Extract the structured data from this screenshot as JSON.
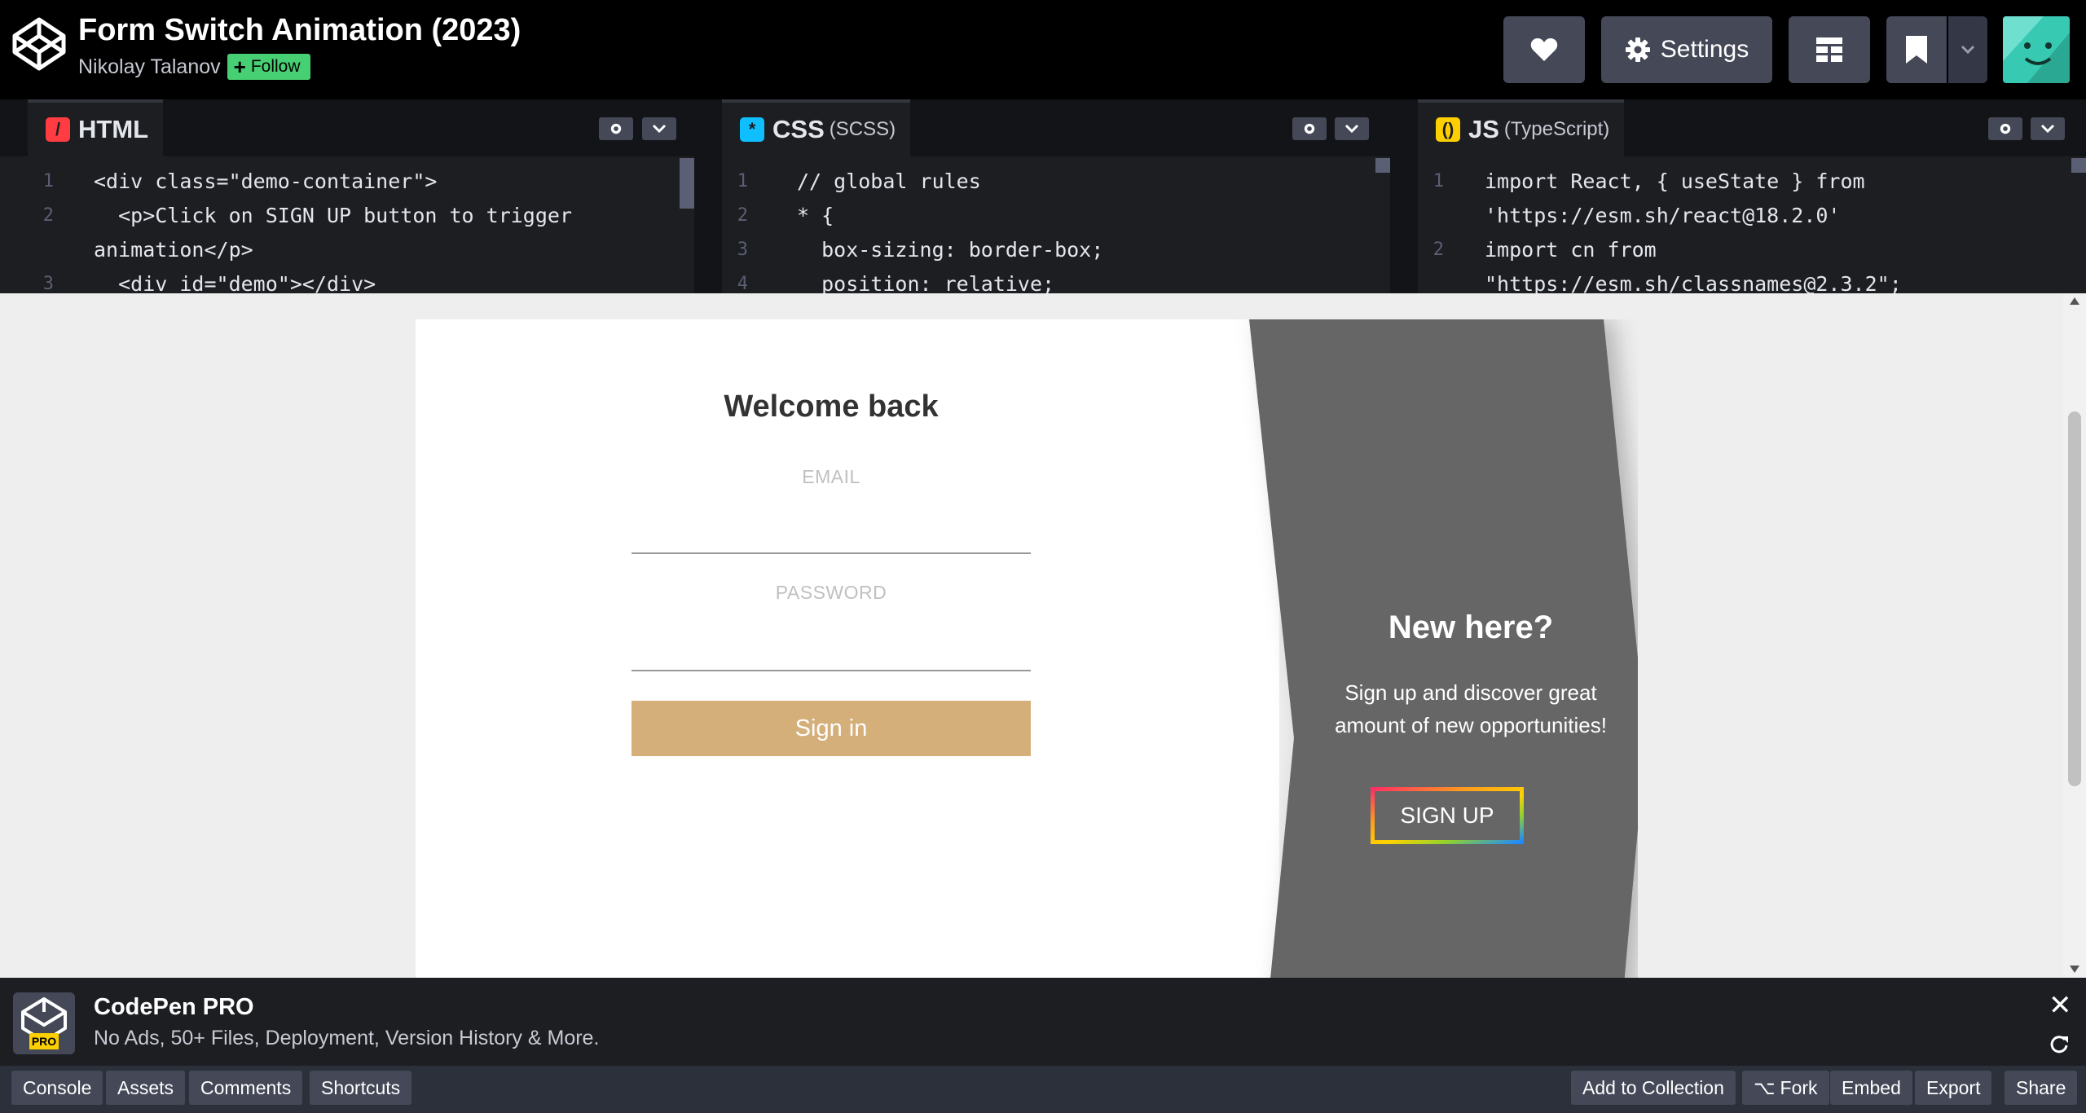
{
  "header": {
    "title": "Form Switch Animation (2023)",
    "author": "Nikolay Talanov",
    "follow_label": "Follow",
    "settings_label": "Settings",
    "icons": [
      "codepen-logo-icon",
      "heart-icon",
      "gear-icon",
      "layout-icon",
      "bookmark-icon",
      "chevron-down-icon"
    ]
  },
  "editors": {
    "html": {
      "name": "HTML",
      "sub": "",
      "icon_color": "#ff3c41",
      "line_numbers": [
        "1",
        "2",
        "",
        "3"
      ],
      "lines": [
        "<div class=\"demo-container\">",
        "  <p>Click on SIGN UP button to trigger",
        "animation</p>",
        "  <div id=\"demo\"></div>"
      ]
    },
    "css": {
      "name": "CSS",
      "sub": "(SCSS)",
      "icon_color": "#0ebeff",
      "line_numbers": [
        "1",
        "2",
        "3",
        "4"
      ],
      "lines": [
        "// global rules",
        "* {",
        "  box-sizing: border-box;",
        "  position: relative;"
      ]
    },
    "js": {
      "name": "JS",
      "sub": "(TypeScript)",
      "icon_color": "#fcd000",
      "line_numbers": [
        "1",
        "",
        "2",
        ""
      ],
      "lines": [
        "import React, { useState } from",
        "'https://esm.sh/react@18.2.0'",
        "import cn from",
        "\"https://esm.sh/classnames@2.3.2\";"
      ]
    }
  },
  "preview": {
    "welcome": "Welcome back",
    "email_label": "EMAIL",
    "password_label": "PASSWORD",
    "signin_label": "Sign in",
    "new_here": "New here?",
    "side_desc_1": "Sign up and discover great",
    "side_desc_2": "amount of new opportunities!",
    "signup_label": "SIGN UP",
    "colors": {
      "signin_bg": "#d4af7a",
      "side_bg": "#666666",
      "page_bg": "#eeeeee"
    }
  },
  "pro_banner": {
    "title": "CodePen PRO",
    "desc": "No Ads, 50+ Files, Deployment, Version History & More.",
    "badge": "PRO"
  },
  "footer": {
    "left": [
      "Console",
      "Assets",
      "Comments",
      "Shortcuts"
    ],
    "add_to_collection": "Add to Collection",
    "fork": "Fork",
    "embed": "Embed",
    "export": "Export",
    "share": "Share"
  }
}
